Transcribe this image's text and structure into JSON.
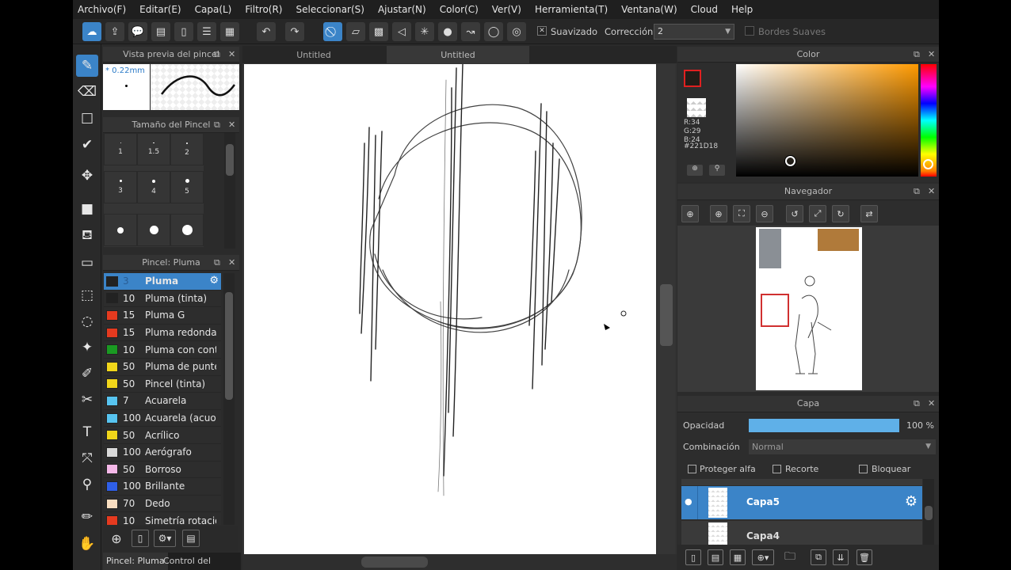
{
  "menubar": [
    "Archivo(F)",
    "Editar(E)",
    "Capa(L)",
    "Filtro(R)",
    "Seleccionar(S)",
    "Ajustar(N)",
    "Color(C)",
    "Ver(V)",
    "Herramienta(T)",
    "Ventana(W)",
    "Cloud",
    "Help"
  ],
  "toolbar": {
    "smoothing_label": "Suavizado",
    "correction_label": "Corrección",
    "correction_value": "2",
    "soft_edges_label": "Bordes Suaves"
  },
  "brush_preview": {
    "title": "Vista previa del pincel",
    "size_text": "* 0.22mm"
  },
  "brush_size": {
    "title": "Tamaño del Pincel",
    "cells": [
      "1",
      "1.5",
      "2",
      "3",
      "4",
      "5",
      "",
      "",
      ""
    ]
  },
  "brush_panel": {
    "title": "Pincel: Pluma",
    "items": [
      {
        "size": "3",
        "name": "Pluma",
        "color": "#222222"
      },
      {
        "size": "10",
        "name": "Pluma (tinta)",
        "color": "#222222"
      },
      {
        "size": "15",
        "name": "Pluma G",
        "color": "#e53a1f"
      },
      {
        "size": "15",
        "name": "Pluma redonda",
        "color": "#e53a1f"
      },
      {
        "size": "10",
        "name": "Pluma con cont",
        "color": "#1a9a22"
      },
      {
        "size": "50",
        "name": "Pluma de punte",
        "color": "#f1d61a"
      },
      {
        "size": "50",
        "name": "Pincel (tinta)",
        "color": "#f1d61a"
      },
      {
        "size": "7",
        "name": "Acuarela",
        "color": "#57c4f0"
      },
      {
        "size": "100",
        "name": "Acuarela (acuo",
        "color": "#57c4f0"
      },
      {
        "size": "50",
        "name": "Acrílico",
        "color": "#f1d61a"
      },
      {
        "size": "100",
        "name": "Aerógrafo",
        "color": "#d8d8d8"
      },
      {
        "size": "50",
        "name": "Borroso",
        "color": "#f4b8e8"
      },
      {
        "size": "100",
        "name": "Brillante",
        "color": "#2f5fe8"
      },
      {
        "size": "70",
        "name": "Dedo",
        "color": "#f8ddc0"
      },
      {
        "size": "10",
        "name": "Simetría rotacio",
        "color": "#e53a1f"
      }
    ]
  },
  "bottom_tabs": [
    "Pincel: Pluma",
    "Control del pincel"
  ],
  "doc_tabs": [
    "Untitled",
    "Untitled"
  ],
  "color_panel": {
    "title": "Color",
    "readout": [
      "R:34",
      "G:29",
      "B:24",
      "#221D18"
    ],
    "foreground": "#221d18"
  },
  "navigator": {
    "title": "Navegador"
  },
  "layer_panel": {
    "title": "Capa",
    "opacity_label": "Opacidad",
    "opacity_value": "100 %",
    "opacity": 1.0,
    "blend_label": "Combinación",
    "blend_value": "Normal",
    "protect_alpha": "Proteger alfa",
    "clipping": "Recorte",
    "lock": "Bloquear",
    "layers": [
      {
        "name": "Capa5",
        "active": true
      },
      {
        "name": "Capa4",
        "active": false
      }
    ]
  },
  "colors": {
    "accent": "#3b84c8",
    "panel_bg": "#2d2d2d"
  }
}
